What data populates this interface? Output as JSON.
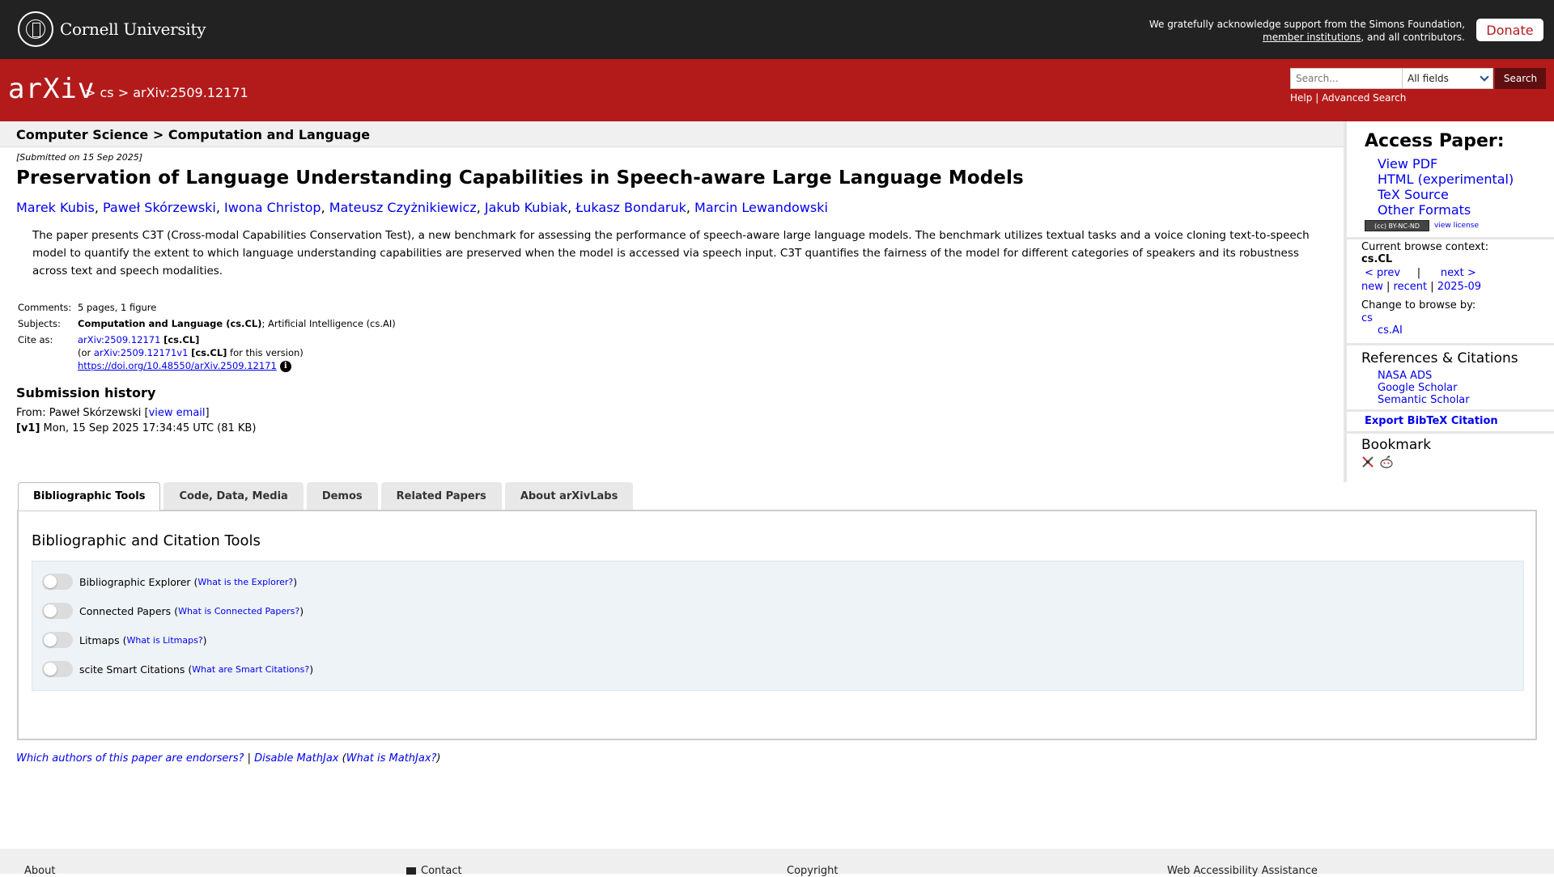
{
  "cornell": {
    "name": "Cornell University",
    "support_line1": "We gratefully acknowledge support from the Simons Foundation,",
    "support_link": "member institutions",
    "support_line2_rest": ", and all contributors.",
    "donate": "Donate"
  },
  "header": {
    "logo": "arXiv",
    "breadcrumb": "> cs > arXiv:2509.12171",
    "search_placeholder": "Search...",
    "field_select": "All fields",
    "search_button": "Search",
    "help": "Help",
    "divider": "|",
    "advanced_search": "Advanced Search"
  },
  "subheader": "Computer Science > Computation and Language",
  "paper": {
    "dateline": "[Submitted on 15 Sep 2025]",
    "title": "Preservation of Language Understanding Capabilities in Speech-aware Large Language Models",
    "authors": [
      "Marek Kubis",
      "Paweł Skórzewski",
      "Iwona Christop",
      "Mateusz Czyżnikiewicz",
      "Jakub Kubiak",
      "Łukasz Bondaruk",
      "Marcin Lewandowski"
    ],
    "abstract": "The paper presents C3T (Cross-modal Capabilities Conservation Test), a new benchmark for assessing the performance of speech-aware large language models. The benchmark utilizes textual tasks and a voice cloning text-to-speech model to quantify the extent to which language understanding capabilities are preserved when the model is accessed via speech input. C3T quantifies the fairness of the model for different categories of speakers and its robustness across text and speech modalities.",
    "comments_label": "Comments:",
    "comments": "5 pages, 1 figure",
    "subjects_label": "Subjects:",
    "subject_primary": "Computation and Language (cs.CL)",
    "subject_secondary": "; Artificial Intelligence (cs.AI)",
    "cite_label": "Cite as:",
    "cite_id": "arXiv:2509.12171",
    "cite_cat": "[cs.CL]",
    "cite_or": "(or ",
    "cite_version": "arXiv:2509.12171v1",
    "cite_version_cat": "[cs.CL]",
    "cite_version_tail": " for this version)",
    "doi": "https://doi.org/10.48550/arXiv.2509.12171",
    "history_title": "Submission history",
    "from_prefix": "From: Paweł Skórzewski [",
    "view_email": "view email",
    "from_suffix": "]",
    "v1_tag": "[v1]",
    "v1_text": " Mon, 15 Sep 2025 17:34:45 UTC (81 KB)"
  },
  "tabs": [
    "Bibliographic Tools",
    "Code, Data, Media",
    "Demos",
    "Related Papers",
    "About arXivLabs"
  ],
  "panel": {
    "title": "Bibliographic and Citation Tools",
    "tools": [
      {
        "name": "Bibliographic Explorer",
        "q": "What is the Explorer?"
      },
      {
        "name": "Connected Papers",
        "q": "What is Connected Papers?"
      },
      {
        "name": "Litmaps",
        "q": "What is Litmaps?"
      },
      {
        "name": "scite Smart Citations",
        "q": "What are Smart Citations?"
      }
    ]
  },
  "bottom": {
    "endorsers": "Which authors of this paper are endorsers?",
    "sep": " | ",
    "disable_mathjax": "Disable MathJax",
    "what_mathjax": "What is MathJax?"
  },
  "sidebar": {
    "access_title": "Access Paper:",
    "access_links": [
      "View PDF",
      "HTML (experimental)",
      "TeX Source",
      "Other Formats"
    ],
    "cc_badge": "(cc) BY-NC-ND",
    "view_license": "view license",
    "browse_label": "Current browse context:",
    "browse_context": "cs.CL",
    "prev": "< prev",
    "pipe": "|",
    "next": "next >",
    "new": "new",
    "recent": "recent",
    "month": "2025-09",
    "change_label": "Change to browse by:",
    "browse_cs": "cs",
    "browse_csai": "cs.AI",
    "refs_title": "References & Citations",
    "refs_links": [
      "NASA ADS",
      "Google Scholar",
      "Semantic Scholar"
    ],
    "export_bibtex": "Export BibTeX Citation",
    "bookmark_title": "Bookmark"
  },
  "footer": {
    "about": "About",
    "contact": "Contact",
    "copyright": "Copyright",
    "accessibility": "Web Accessibility Assistance"
  },
  "colors": {
    "arxiv_red": "#b31b1b",
    "cornell_bar": "#222222",
    "link_blue": "#0000ee"
  }
}
